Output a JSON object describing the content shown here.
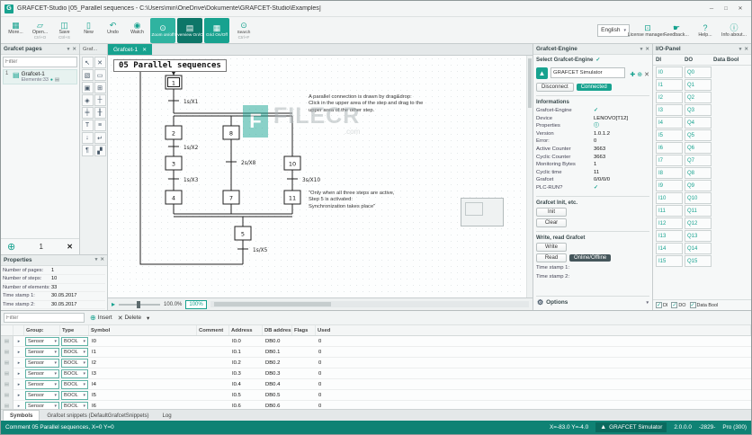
{
  "ui": {
    "check": "✓",
    "chevron": "▾",
    "pin": "▾",
    "close": "✕",
    "dot": "●",
    "add": "⊕",
    "gear": "⚙",
    "expand": "▸",
    "handle": "▤",
    "page": "▤",
    "logo": "▲",
    "info": "ⓘ"
  },
  "window": {
    "app_glyph": "G",
    "title": "GRAFCET-Studio [05_Parallel sequences - C:\\Users\\min\\OneDrive\\Dokumente\\GRAFCET-Studio\\Examples]",
    "controls": [
      {
        "name": "minimize",
        "glyph": "─"
      },
      {
        "name": "maximize",
        "glyph": "□"
      },
      {
        "name": "close",
        "glyph": "✕"
      }
    ]
  },
  "toolbar": {
    "main_buttons": [
      {
        "label": "More...",
        "icon": "more-icon",
        "glyph": "▦"
      },
      {
        "label": "Open...",
        "sublabel": "Ctrl+O",
        "icon": "open-folder-icon",
        "glyph": "▱"
      },
      {
        "label": "Save",
        "sublabel": "Ctrl+S",
        "icon": "save-icon",
        "glyph": "◫"
      },
      {
        "label": "New",
        "icon": "new-page-icon",
        "glyph": "▯"
      },
      {
        "label": "Undo",
        "icon": "undo-icon",
        "glyph": "↶"
      },
      {
        "label": "Watch",
        "icon": "watch-icon",
        "glyph": "◉"
      }
    ],
    "toggle_buttons": [
      {
        "label": "Zoom on/off",
        "icon": "zoom-icon",
        "glyph": "⊙",
        "style": "light"
      },
      {
        "label": "Overview On/Off",
        "icon": "overview-icon",
        "glyph": "▤",
        "style": "dark"
      },
      {
        "label": "Grid On/Off",
        "icon": "grid-icon",
        "glyph": "▦",
        "style": "teal"
      },
      {
        "label": "Search",
        "sublabel": "Ctrl+F",
        "icon": "search-icon",
        "glyph": "⊙",
        "style": "plain"
      }
    ],
    "language": "English",
    "right_buttons": [
      {
        "label": "License manager...",
        "icon": "license-manager-icon",
        "glyph": "⊡"
      },
      {
        "label": "Feedback...",
        "icon": "feedback-icon",
        "glyph": "☛"
      },
      {
        "label": "Help...",
        "icon": "help-icon",
        "glyph": "?"
      },
      {
        "label": "Info about...",
        "icon": "info-icon",
        "glyph": "ⓘ"
      }
    ]
  },
  "pages": {
    "title": "Grafcet pages",
    "filter_placeholder": "Filter",
    "item_index": "1",
    "item_name": "Grafcet-1",
    "item_sub": "Elemente:33",
    "count": "1"
  },
  "properties": {
    "title": "Properties",
    "rows": [
      {
        "label": "Number of pages:",
        "value": "1"
      },
      {
        "label": "Number of steps:",
        "value": "10"
      },
      {
        "label": "Number of elements:",
        "value": "33"
      },
      {
        "label": "Time stamp 1:",
        "value": "30.05.2017"
      },
      {
        "label": "Time stamp 2:",
        "value": "30.05.2017"
      }
    ]
  },
  "palette": {
    "tab": "Graf...",
    "tools": [
      {
        "name": "select-tool",
        "glyph": "↖"
      },
      {
        "name": "delete-tool",
        "glyph": "✕"
      },
      {
        "name": "zoom-region-tool",
        "glyph": "▧"
      },
      {
        "name": "step-tool",
        "glyph": "▭"
      },
      {
        "name": "initial-step-tool",
        "glyph": "▣"
      },
      {
        "name": "macro-step-tool",
        "glyph": "⊞"
      },
      {
        "name": "enclosing-step-tool",
        "glyph": "◈"
      },
      {
        "name": "transition-tool",
        "glyph": "┼"
      },
      {
        "name": "parallel-branch-tool",
        "glyph": "╪"
      },
      {
        "name": "alternative-branch-tool",
        "glyph": "╫"
      },
      {
        "name": "text-tool",
        "glyph": "T"
      },
      {
        "name": "document-tool",
        "glyph": "≡"
      },
      {
        "name": "arrow-down-tool",
        "glyph": "↓"
      },
      {
        "name": "jump-tool",
        "glyph": "↵"
      },
      {
        "name": "comment-tool",
        "glyph": "¶"
      },
      {
        "name": "chart-tool",
        "glyph": "▞"
      }
    ]
  },
  "canvas": {
    "tab": "Grafcet-1",
    "zoom_value": "100.0%",
    "zoom_button": "100%"
  },
  "diagram": {
    "title": "05 Parallel sequences",
    "steps": {
      "s1": "1",
      "s2": "2",
      "s3": "3",
      "s4": "4",
      "s8": "8",
      "s7": "7",
      "s10": "10",
      "s11": "11",
      "s5": "5"
    },
    "transitions": {
      "t1": "1s/X1",
      "t2": "1s/X2",
      "t3": "1s/X3",
      "t4": "2s/X8",
      "t5": "3s/X10",
      "t6": "1s/X5"
    },
    "annotation1": "A parallel connection is drawn by drag&drop:\nClick in the upper area of the step and drag to the\nupper area of the other step.",
    "annotation2": "\"Only when all three steps are active,\nStep 5 is activated:\nSynchronization takes place\"",
    "watermark_logo": "F",
    "watermark_text": "FILECR",
    "watermark_sub": ".com"
  },
  "engine": {
    "title": "Grafcet-Engine",
    "select_label": "Select Grafcet-Engine",
    "engine_name": "GRAFCET Simulator",
    "tool_icons": [
      {
        "name": "engine-monitor-icon",
        "glyph": "✚"
      },
      {
        "name": "engine-target-icon",
        "glyph": "⊕"
      },
      {
        "name": "engine-remove-icon",
        "glyph": "✕"
      }
    ],
    "disconnect_label": "Disconnect",
    "connected_label": "Connected",
    "informations_title": "Informations",
    "info_rows": [
      {
        "label": "Grafcet-Engine",
        "value": "✓",
        "accent": true
      },
      {
        "label": "Device",
        "value": "LENOVO[T12]"
      },
      {
        "label": "Properties",
        "value": "ⓘ",
        "accent": true
      },
      {
        "label": "Version",
        "value": "1.0.1.2"
      },
      {
        "label": "Error:",
        "value": "0"
      },
      {
        "label": "Active Counter",
        "value": "3663"
      },
      {
        "label": "Cyclic Counter",
        "value": "3663"
      },
      {
        "label": "Monitoring Bytes",
        "value": "1"
      },
      {
        "label": "Cyclic time",
        "value": "11"
      },
      {
        "label": "Grafcet",
        "value": "0/0/0/0"
      },
      {
        "label": "PLC-RUN?",
        "value": "✓",
        "accent": true
      }
    ],
    "init_title": "Grafcet Init, etc.",
    "init_label": "Init",
    "clear_label": "Clear",
    "write_title": "Write, read Grafcet",
    "write_label": "Write",
    "read_label": "Read",
    "online_offline_label": "Online/Offline",
    "time1_label": "Time stamp 1:",
    "time2_label": "Time stamp 2:",
    "options_label": "Options"
  },
  "io_panel": {
    "title": "I/O-Panel",
    "columns": [
      "DI",
      "DO",
      "Data Bool"
    ],
    "di": [
      "I0",
      "I1",
      "I2",
      "I3",
      "I4",
      "I5",
      "I6",
      "I7",
      "I8",
      "I9",
      "I10",
      "I11",
      "I12",
      "I13",
      "I14",
      "I15"
    ],
    "do": [
      "Q0",
      "Q1",
      "Q2",
      "Q3",
      "Q4",
      "Q5",
      "Q6",
      "Q7",
      "Q8",
      "Q9",
      "Q10",
      "Q11",
      "Q12",
      "Q13",
      "Q14",
      "Q15"
    ],
    "checkboxes": [
      "DI",
      "DO",
      "Data Bool"
    ]
  },
  "symbols": {
    "filter_placeholder": "Filter",
    "insert_label": "Insert",
    "delete_label": "Delete",
    "headers": [
      "Group:",
      "Type",
      "Symbol",
      "Comment",
      "Address",
      "DB address",
      "Flags",
      "Used"
    ],
    "rows": [
      {
        "group": "Sensor",
        "type": "BOOL",
        "symbol": "I0",
        "comment": "",
        "address": "I0.0",
        "db_address": "DB0.0",
        "flags": "",
        "used": "0"
      },
      {
        "group": "Sensor",
        "type": "BOOL",
        "symbol": "I1",
        "comment": "",
        "address": "I0.1",
        "db_address": "DB0.1",
        "flags": "",
        "used": "0"
      },
      {
        "group": "Sensor",
        "type": "BOOL",
        "symbol": "I2",
        "comment": "",
        "address": "I0.2",
        "db_address": "DB0.2",
        "flags": "",
        "used": "0"
      },
      {
        "group": "Sensor",
        "type": "BOOL",
        "symbol": "I3",
        "comment": "",
        "address": "I0.3",
        "db_address": "DB0.3",
        "flags": "",
        "used": "0"
      },
      {
        "group": "Sensor",
        "type": "BOOL",
        "symbol": "I4",
        "comment": "",
        "address": "I0.4",
        "db_address": "DB0.4",
        "flags": "",
        "used": "0"
      },
      {
        "group": "Sensor",
        "type": "BOOL",
        "symbol": "I5",
        "comment": "",
        "address": "I0.5",
        "db_address": "DB0.5",
        "flags": "",
        "used": "0"
      },
      {
        "group": "Sensor",
        "type": "BOOL",
        "symbol": "I6",
        "comment": "",
        "address": "I0.6",
        "db_address": "DB0.6",
        "flags": "",
        "used": "0"
      }
    ]
  },
  "bottom_tabs": [
    {
      "label": "Symbols",
      "active": true
    },
    {
      "label": "Grafcet snippets (DefaultGrafcetSnippets)",
      "active": false
    },
    {
      "label": "Log",
      "active": false
    }
  ],
  "status": {
    "left": "Comment 05 Parallel sequences, X=0 Y=0",
    "coords": "X=-83.0  Y=-4.0",
    "engine": "GRAFCET Simulator",
    "version": "2.0.0.0",
    "build": "-2829-",
    "edition": "Pro (300)"
  }
}
